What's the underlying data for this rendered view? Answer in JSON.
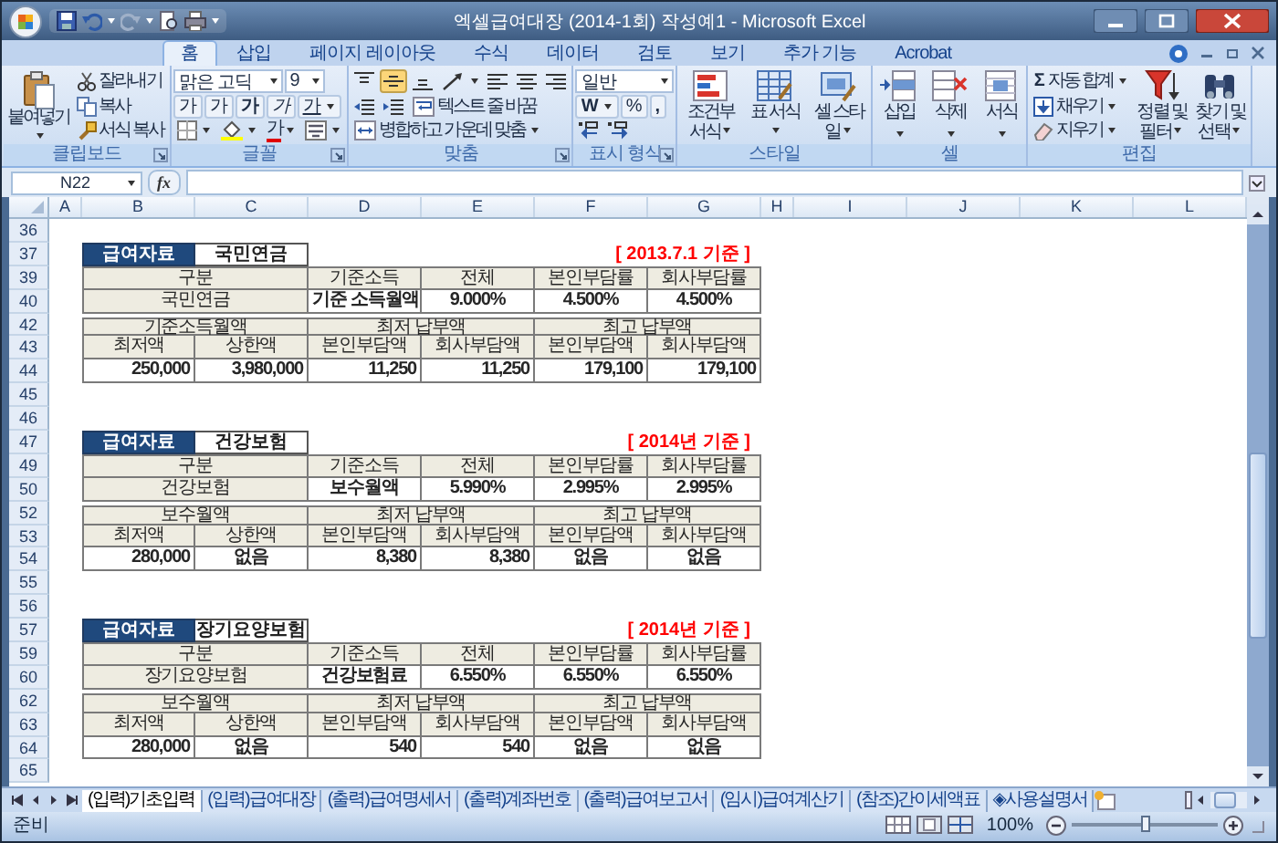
{
  "window": {
    "title": "엑셀급여대장 (2014-1회) 작성예1 - Microsoft Excel"
  },
  "ribbon_tabs": [
    {
      "label": "홈",
      "selected": true
    },
    {
      "label": "삽입",
      "selected": false
    },
    {
      "label": "페이지 레이아웃",
      "selected": false
    },
    {
      "label": "수식",
      "selected": false
    },
    {
      "label": "데이터",
      "selected": false
    },
    {
      "label": "검토",
      "selected": false
    },
    {
      "label": "보기",
      "selected": false
    },
    {
      "label": "추가 기능",
      "selected": false
    },
    {
      "label": "Acrobat",
      "selected": false
    }
  ],
  "ribbon": {
    "groups": [
      {
        "kind": "clipboard",
        "label": "클립보드",
        "launcher": true,
        "paste": "붙여넣기",
        "cut": "잘라내기",
        "copy": "복사",
        "format_painter": "서식 복사"
      },
      {
        "kind": "font",
        "label": "글꼴",
        "launcher": true,
        "font_name": "맑은 고딕",
        "font_size": "9",
        "grow": "가",
        "shrink": "가",
        "bold": "가",
        "italic": "가",
        "underline": "가",
        "font_color": "가"
      },
      {
        "kind": "alignment",
        "label": "맞춤",
        "launcher": true,
        "valign_buttons": [
          {
            "selected": false
          },
          {
            "selected": true
          },
          {
            "selected": false
          }
        ],
        "wrap_text": "텍스트 줄 바꿈",
        "merge_center": "병합하고 가운데 맞춤"
      },
      {
        "kind": "number",
        "label": "표시 형식",
        "launcher": true,
        "format": "일반",
        "currency": "W",
        "percent": "%",
        "comma": ","
      },
      {
        "kind": "styles",
        "label": "스타일",
        "launcher": false,
        "buttons": [
          "조건부 서식",
          "표 서식",
          "셀 스타일"
        ]
      },
      {
        "kind": "cells",
        "label": "셀",
        "launcher": false,
        "buttons": [
          "삽입",
          "삭제",
          "서식"
        ]
      },
      {
        "kind": "editing",
        "label": "편집",
        "launcher": false,
        "sum_symbol": "Σ",
        "autosum": "자동 합계",
        "fill": "채우기",
        "clear": "지우기",
        "big_buttons": [
          "정렬 및 필터",
          "찾기 및 선택"
        ]
      }
    ]
  },
  "formula_bar": {
    "name_box": "N22",
    "function_button": "fx"
  },
  "sheet": {
    "columns": [
      "A",
      "B",
      "C",
      "D",
      "E",
      "F",
      "G",
      "H",
      "I",
      "J",
      "K",
      "L"
    ],
    "row_headers": [
      "36",
      "37",
      "39",
      "40",
      "42",
      "43",
      "44",
      "45",
      "46",
      "47",
      "49",
      "50",
      "52",
      "53",
      "54",
      "55",
      "56",
      "57",
      "59",
      "60",
      "62",
      "63",
      "64",
      "65"
    ],
    "sections": [
      {
        "label": "급여자료",
        "title": "국민연금",
        "note": "[ 2013.7.1 기준 ]",
        "rate_table": {
          "columns": [
            "구분",
            "기준소득",
            "전체",
            "본인부담률",
            "회사부담률"
          ],
          "values": [
            "국민연금",
            "기준 소득월액",
            "9.000%",
            "4.500%",
            "4.500%"
          ]
        },
        "amount_table": {
          "groups": [
            "기준소득월액",
            "최저 납부액",
            "최고 납부액"
          ],
          "columns": [
            "최저액",
            "상한액",
            "본인부담액",
            "회사부담액",
            "본인부담액",
            "회사부담액"
          ],
          "values": [
            {
              "text": "250,000",
              "kind": "number"
            },
            {
              "text": "3,980,000",
              "kind": "number"
            },
            {
              "text": "11,250",
              "kind": "number"
            },
            {
              "text": "11,250",
              "kind": "number"
            },
            {
              "text": "179,100",
              "kind": "number"
            },
            {
              "text": "179,100",
              "kind": "number"
            }
          ]
        }
      },
      {
        "label": "급여자료",
        "title": "건강보험",
        "note": "[ 2014년 기준 ]",
        "rate_table": {
          "columns": [
            "구분",
            "기준소득",
            "전체",
            "본인부담률",
            "회사부담률"
          ],
          "values": [
            "건강보험",
            "보수월액",
            "5.990%",
            "2.995%",
            "2.995%"
          ]
        },
        "amount_table": {
          "groups": [
            "보수월액",
            "최저 납부액",
            "최고 납부액"
          ],
          "columns": [
            "최저액",
            "상한액",
            "본인부담액",
            "회사부담액",
            "본인부담액",
            "회사부담액"
          ],
          "values": [
            {
              "text": "280,000",
              "kind": "number"
            },
            {
              "text": "없음",
              "kind": "text"
            },
            {
              "text": "8,380",
              "kind": "number"
            },
            {
              "text": "8,380",
              "kind": "number"
            },
            {
              "text": "없음",
              "kind": "text"
            },
            {
              "text": "없음",
              "kind": "text"
            }
          ]
        }
      },
      {
        "label": "급여자료",
        "title": "장기요양보험",
        "note": "[ 2014년 기준 ]",
        "rate_table": {
          "columns": [
            "구분",
            "기준소득",
            "전체",
            "본인부담률",
            "회사부담률"
          ],
          "values": [
            "장기요양보험",
            "건강보험료",
            "6.550%",
            "6.550%",
            "6.550%"
          ]
        },
        "amount_table": {
          "groups": [
            "보수월액",
            "최저 납부액",
            "최고 납부액"
          ],
          "columns": [
            "최저액",
            "상한액",
            "본인부담액",
            "회사부담액",
            "본인부담액",
            "회사부담액"
          ],
          "values": [
            {
              "text": "280,000",
              "kind": "number"
            },
            {
              "text": "없음",
              "kind": "text"
            },
            {
              "text": "540",
              "kind": "number"
            },
            {
              "text": "540",
              "kind": "number"
            },
            {
              "text": "없음",
              "kind": "text"
            },
            {
              "text": "없음",
              "kind": "text"
            }
          ]
        }
      }
    ]
  },
  "sheet_tabs": [
    {
      "label": "(입력)기초입력",
      "selected": true
    },
    {
      "label": "(입력)급여대장",
      "selected": false
    },
    {
      "label": "(출력)급여명세서",
      "selected": false
    },
    {
      "label": "(출력)계좌번호",
      "selected": false
    },
    {
      "label": "(출력)급여보고서",
      "selected": false
    },
    {
      "label": "(임시)급여계산기",
      "selected": false
    },
    {
      "label": "(참조)간이세액표",
      "selected": false
    },
    {
      "label": "◈사용설명서",
      "selected": false
    }
  ],
  "status_bar": {
    "status": "준비",
    "zoom": "100%",
    "zoom_slider": {
      "level": 0.5
    }
  }
}
